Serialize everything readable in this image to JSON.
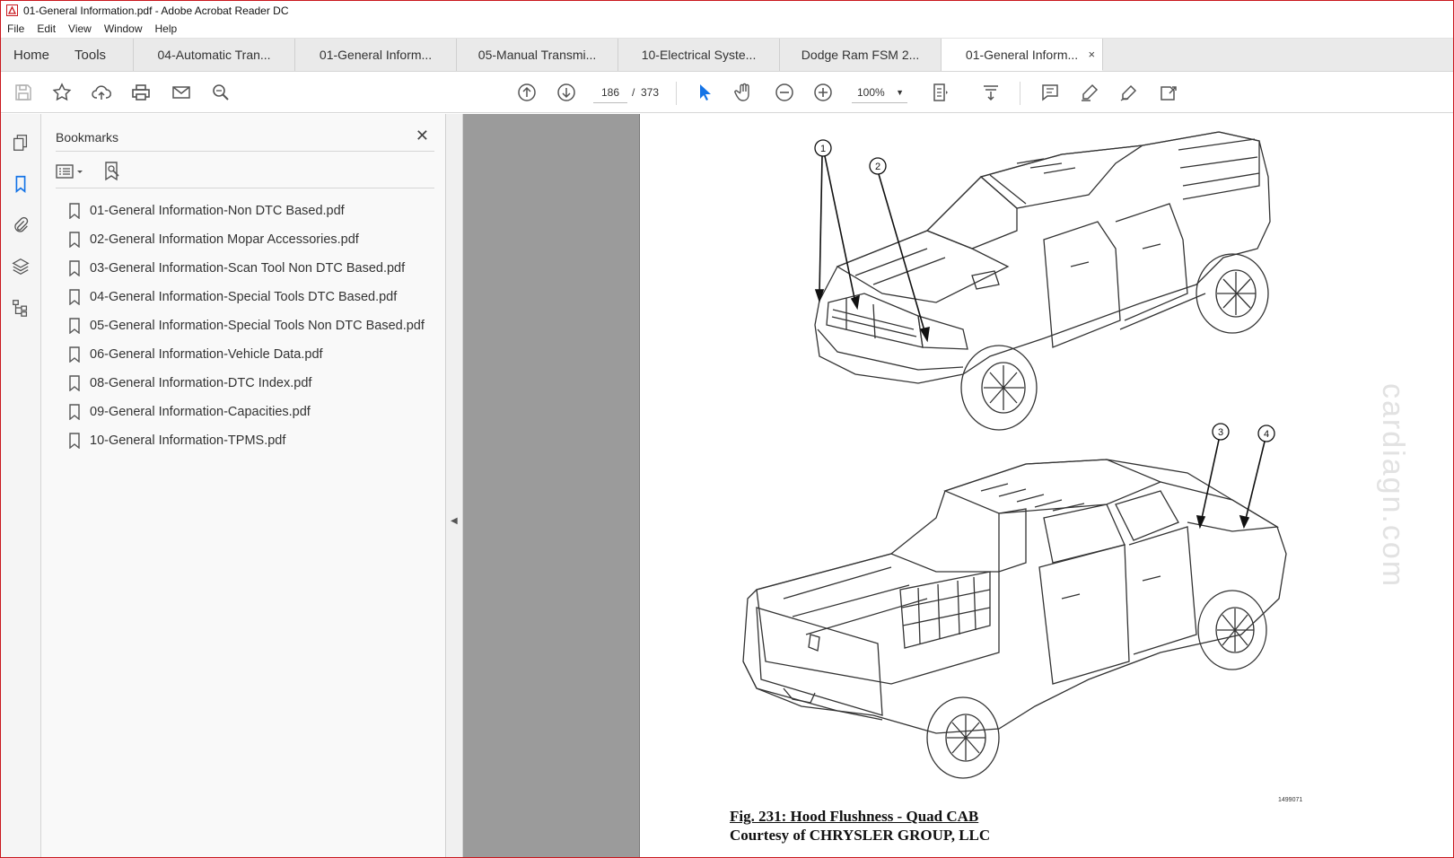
{
  "window": {
    "title": "01-General Information.pdf - Adobe Acrobat Reader DC"
  },
  "menu": [
    "File",
    "Edit",
    "View",
    "Window",
    "Help"
  ],
  "tabs": {
    "home": "Home",
    "tools": "Tools",
    "documents": [
      {
        "label": "04-Automatic Tran..."
      },
      {
        "label": "01-General Inform..."
      },
      {
        "label": "05-Manual Transmi..."
      },
      {
        "label": "10-Electrical Syste..."
      },
      {
        "label": "Dodge Ram FSM 2..."
      },
      {
        "label": "01-General Inform...",
        "active": true
      }
    ],
    "close_glyph": "×"
  },
  "toolbar": {
    "current_page": "186",
    "page_separator": "/",
    "total_pages": "373",
    "zoom": "100%"
  },
  "bookmarks": {
    "title": "Bookmarks",
    "close_glyph": "✕",
    "items": [
      "01-General Information-Non DTC Based.pdf",
      "02-General Information Mopar Accessories.pdf",
      "03-General Information-Scan Tool Non DTC Based.pdf",
      "04-General Information-Special Tools DTC Based.pdf",
      "05-General Information-Special Tools Non DTC Based.pdf",
      "06-General Information-Vehicle Data.pdf",
      "08-General Information-DTC Index.pdf",
      "09-General Information-Capacities.pdf",
      "10-General Information-TPMS.pdf"
    ]
  },
  "document": {
    "callouts": [
      "1",
      "2",
      "3",
      "4"
    ],
    "figure_id": "1499071",
    "caption": "Fig. 231: Hood Flushness - Quad CAB",
    "courtesy": "Courtesy of CHRYSLER GROUP, LLC",
    "watermark": "cardiagn.com"
  },
  "colors": {
    "accent": "#1473e6",
    "frame_border": "#c9181e",
    "doc_background": "#9b9b9b"
  }
}
